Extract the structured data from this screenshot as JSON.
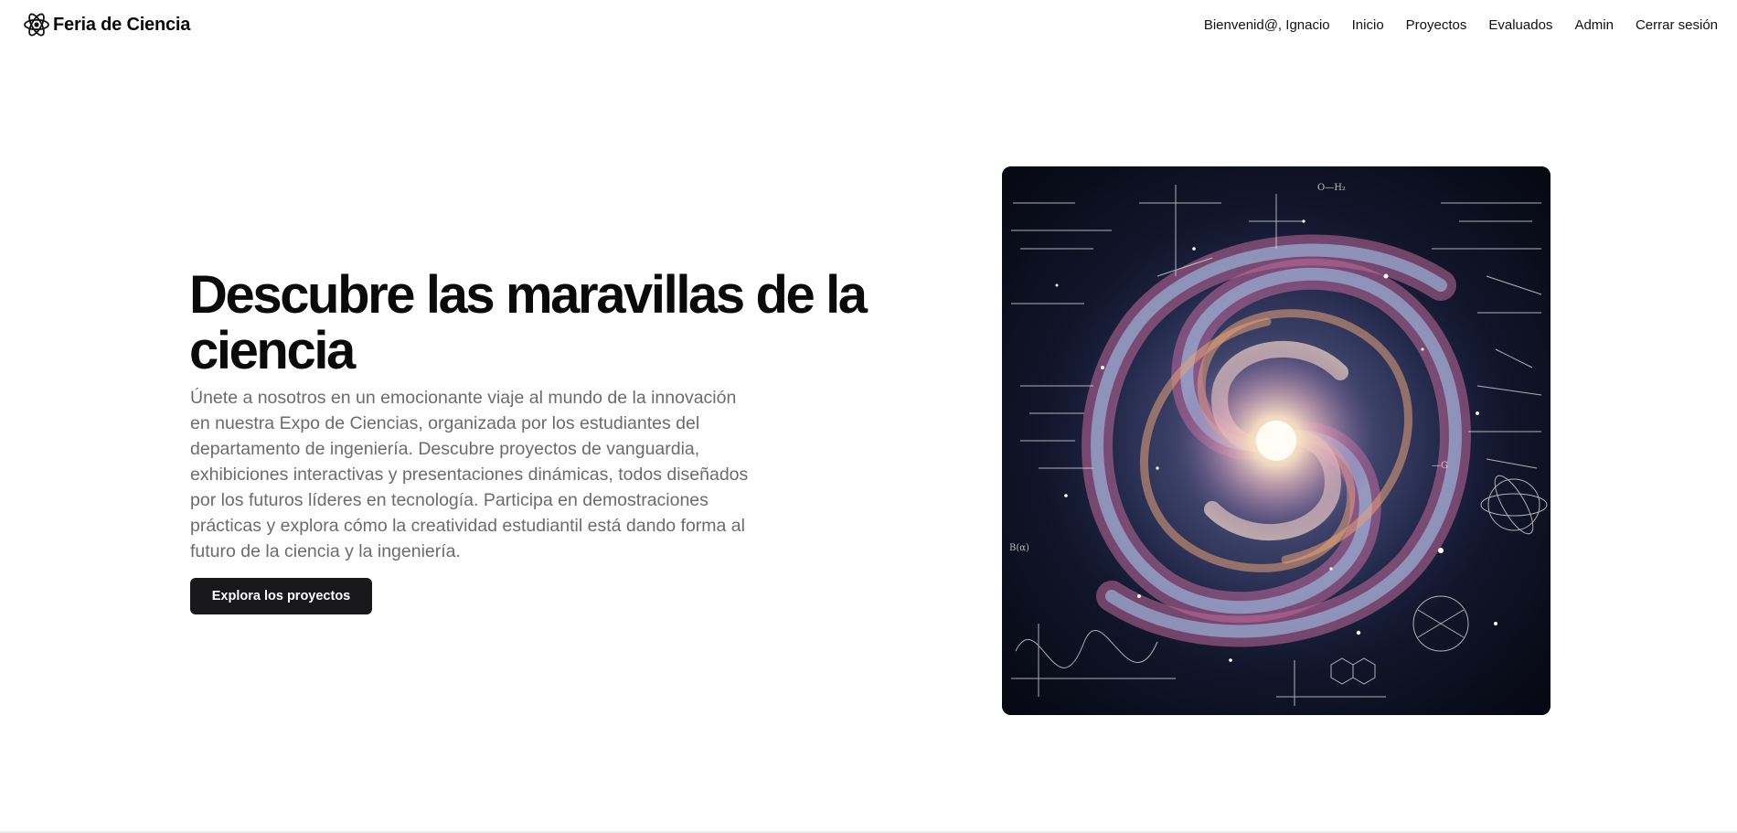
{
  "brand": {
    "name": "Feria de Ciencia",
    "icon": "atom-icon"
  },
  "nav": {
    "greeting": "Bienvenid@, Ignacio",
    "items": [
      "Inicio",
      "Proyectos",
      "Evaluados",
      "Admin",
      "Cerrar sesión"
    ]
  },
  "hero": {
    "title": "Descubre las maravillas de la ciencia",
    "description": "Únete a nosotros en un emocionante viaje al mundo de la innovación en nuestra Expo de Ciencias, organizada por los estudiantes del departamento de ingeniería. Descubre proyectos de vanguardia, exhibiciones interactivas y presentaciones dinámicas, todos diseñados por los futuros líderes en tecnología. Participa en demostraciones prácticas y explora cómo la creatividad estudiantil está dando forma al futuro de la ciencia y la ingeniería.",
    "cta_label": "Explora los proyectos",
    "image": "spiral-galaxy-equations-image"
  },
  "colors": {
    "button_bg": "#18181b",
    "text_muted": "#6b6b6b",
    "title": "#0a0a0a"
  }
}
